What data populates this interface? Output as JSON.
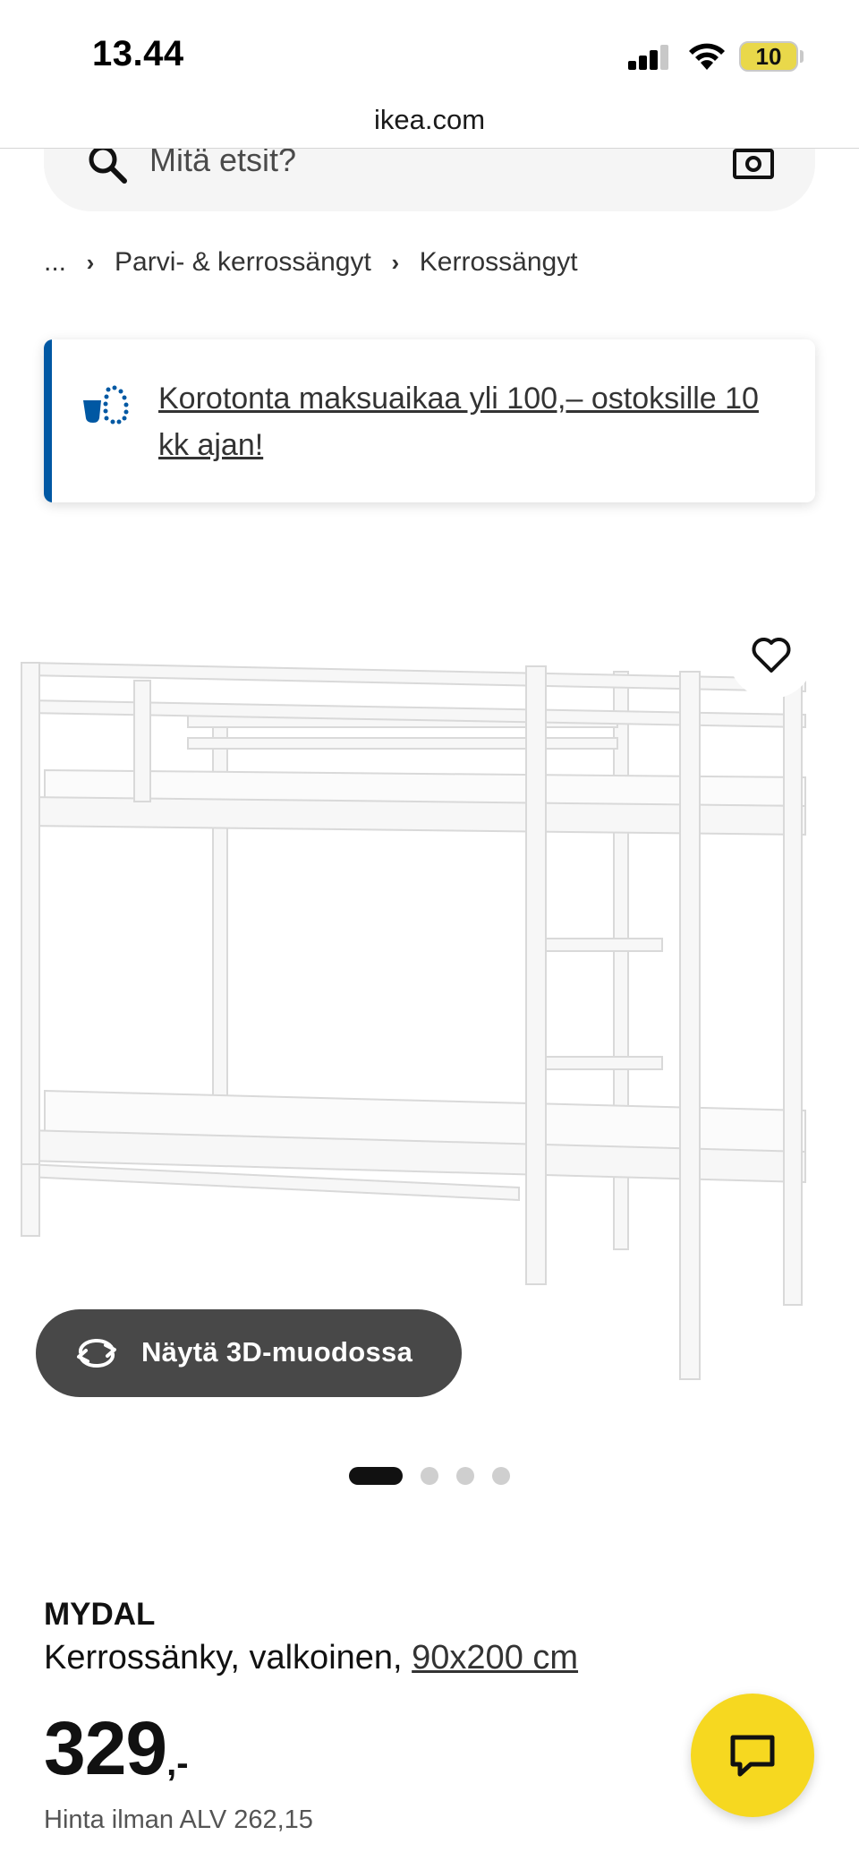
{
  "status_bar": {
    "time": "13.44",
    "battery": "10"
  },
  "browser": {
    "url": "ikea.com"
  },
  "search": {
    "placeholder": "Mitä etsit?"
  },
  "breadcrumb": {
    "items": [
      "...",
      "Parvi- & kerrossängyt",
      "Kerrossängyt"
    ]
  },
  "promo": {
    "text": "Korotonta maksuaikaa yli 100,– ostoksille 10 kk ajan!"
  },
  "gallery": {
    "view_3d_label": "Näytä 3D-muodossa",
    "image_count": 4,
    "active_index": 0
  },
  "product": {
    "name": "MYDAL",
    "description": "Kerrossänky, valkoinen, ",
    "size": "90x200 cm",
    "price": "329",
    "price_suffix": ",-",
    "price_without_vat": "Hinta ilman ALV 262,15"
  },
  "colors": {
    "accent_blue": "#0058a3",
    "chat_yellow": "#f6d820",
    "button_dark": "#484848"
  },
  "icons": [
    "search-icon",
    "camera-icon",
    "chevron-right-icon",
    "installment-icon",
    "heart-icon",
    "rotate-3d-icon",
    "chat-icon"
  ]
}
